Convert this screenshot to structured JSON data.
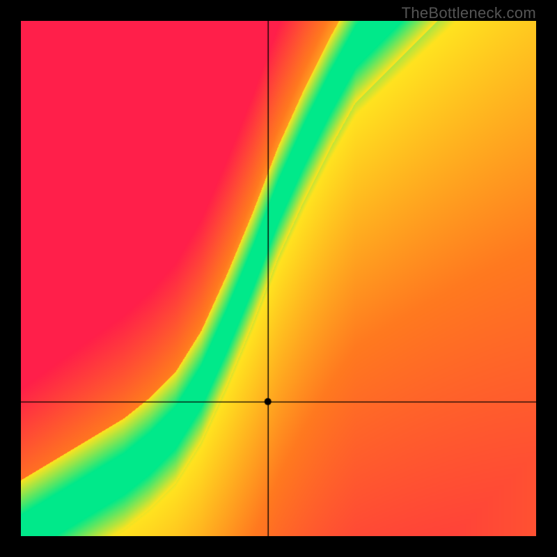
{
  "watermark": "TheBottleneck.com",
  "colors": {
    "red": "#ff1f4a",
    "orange": "#ff7a1f",
    "yellow": "#ffe31f",
    "green": "#00e98a",
    "black": "#000000",
    "cross": "#000000"
  },
  "chart_data": {
    "type": "heatmap",
    "title": "",
    "xlabel": "",
    "ylabel": "",
    "x_range": [
      0,
      100
    ],
    "y_range": [
      0,
      100
    ],
    "crosshair": {
      "x": 48,
      "y": 26
    },
    "marker": {
      "x": 48,
      "y": 26,
      "r": 5
    },
    "optimal_curve_xy": [
      [
        0,
        0
      ],
      [
        5,
        3
      ],
      [
        10,
        6
      ],
      [
        15,
        9
      ],
      [
        20,
        12
      ],
      [
        25,
        16
      ],
      [
        30,
        21
      ],
      [
        35,
        29
      ],
      [
        40,
        40
      ],
      [
        45,
        52
      ],
      [
        50,
        65
      ],
      [
        55,
        76
      ],
      [
        60,
        86
      ],
      [
        65,
        95
      ],
      [
        70,
        100
      ]
    ],
    "optimal_band_halfwidth_y": 4.0,
    "gradient_stops": [
      {
        "d": 0.0,
        "c": "green"
      },
      {
        "d": 0.06,
        "c": "yellow"
      },
      {
        "d": 0.35,
        "c": "orange"
      },
      {
        "d": 0.8,
        "c": "red"
      },
      {
        "d": 1.0,
        "c": "red"
      }
    ],
    "note": "Values are in percent of axis range. 'd' in gradient_stops is normalized distance from the optimal curve (0 = on curve, 1 = far). Region below/right of curve trends orange/yellow; above/left trends red faster."
  }
}
